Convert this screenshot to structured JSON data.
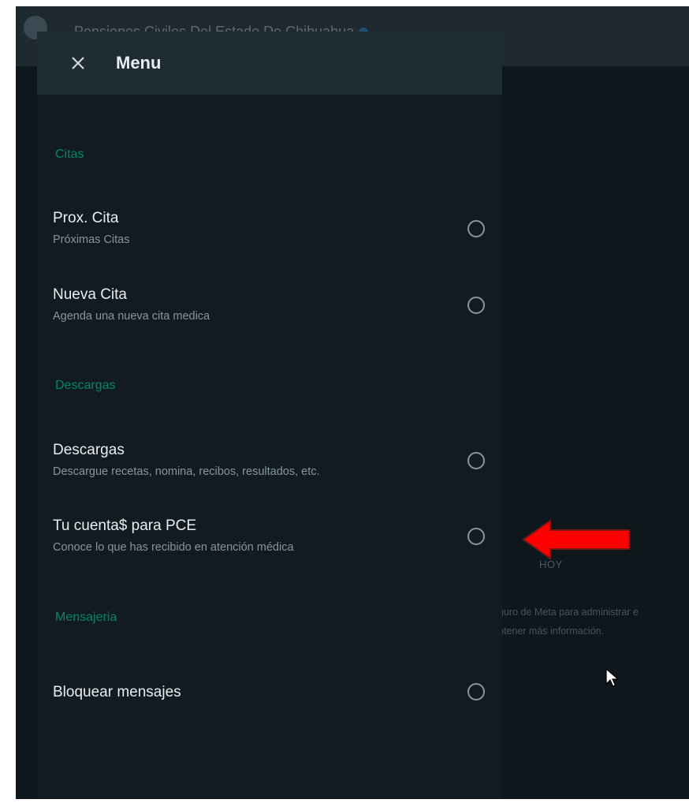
{
  "background": {
    "header_title": "Pensiones Civiles Del Estado De Chihuahua",
    "date_chip": "HOY",
    "system_note_line1": "guro de Meta para administrar e",
    "system_note_line2": "btener más información."
  },
  "drawer": {
    "title": "Menu",
    "sections": [
      {
        "label": "Citas",
        "items": [
          {
            "title": "Prox. Cita",
            "subtitle": "Próximas Citas"
          },
          {
            "title": "Nueva Cita",
            "subtitle": "Agenda una nueva cita medica"
          }
        ]
      },
      {
        "label": "Descargas",
        "items": [
          {
            "title": "Descargas",
            "subtitle": "Descargue recetas, nomina, recibos, resultados, etc."
          },
          {
            "title": "Tu cuenta$ para PCE",
            "subtitle": "Conoce lo que has recibido en atención médica"
          }
        ]
      },
      {
        "label": "Mensajeria",
        "items": [
          {
            "title": "Bloquear mensajes",
            "subtitle": ""
          }
        ]
      }
    ]
  },
  "colors": {
    "accent": "#00a884",
    "annotation_arrow": "#ff0000",
    "drawer_bg": "#111b21",
    "header_bg": "#202c33"
  },
  "icons": {
    "close": "close-icon",
    "radio": "radio-unselected-icon",
    "arrow": "red-arrow-left-icon",
    "cursor": "mouse-pointer-icon"
  }
}
